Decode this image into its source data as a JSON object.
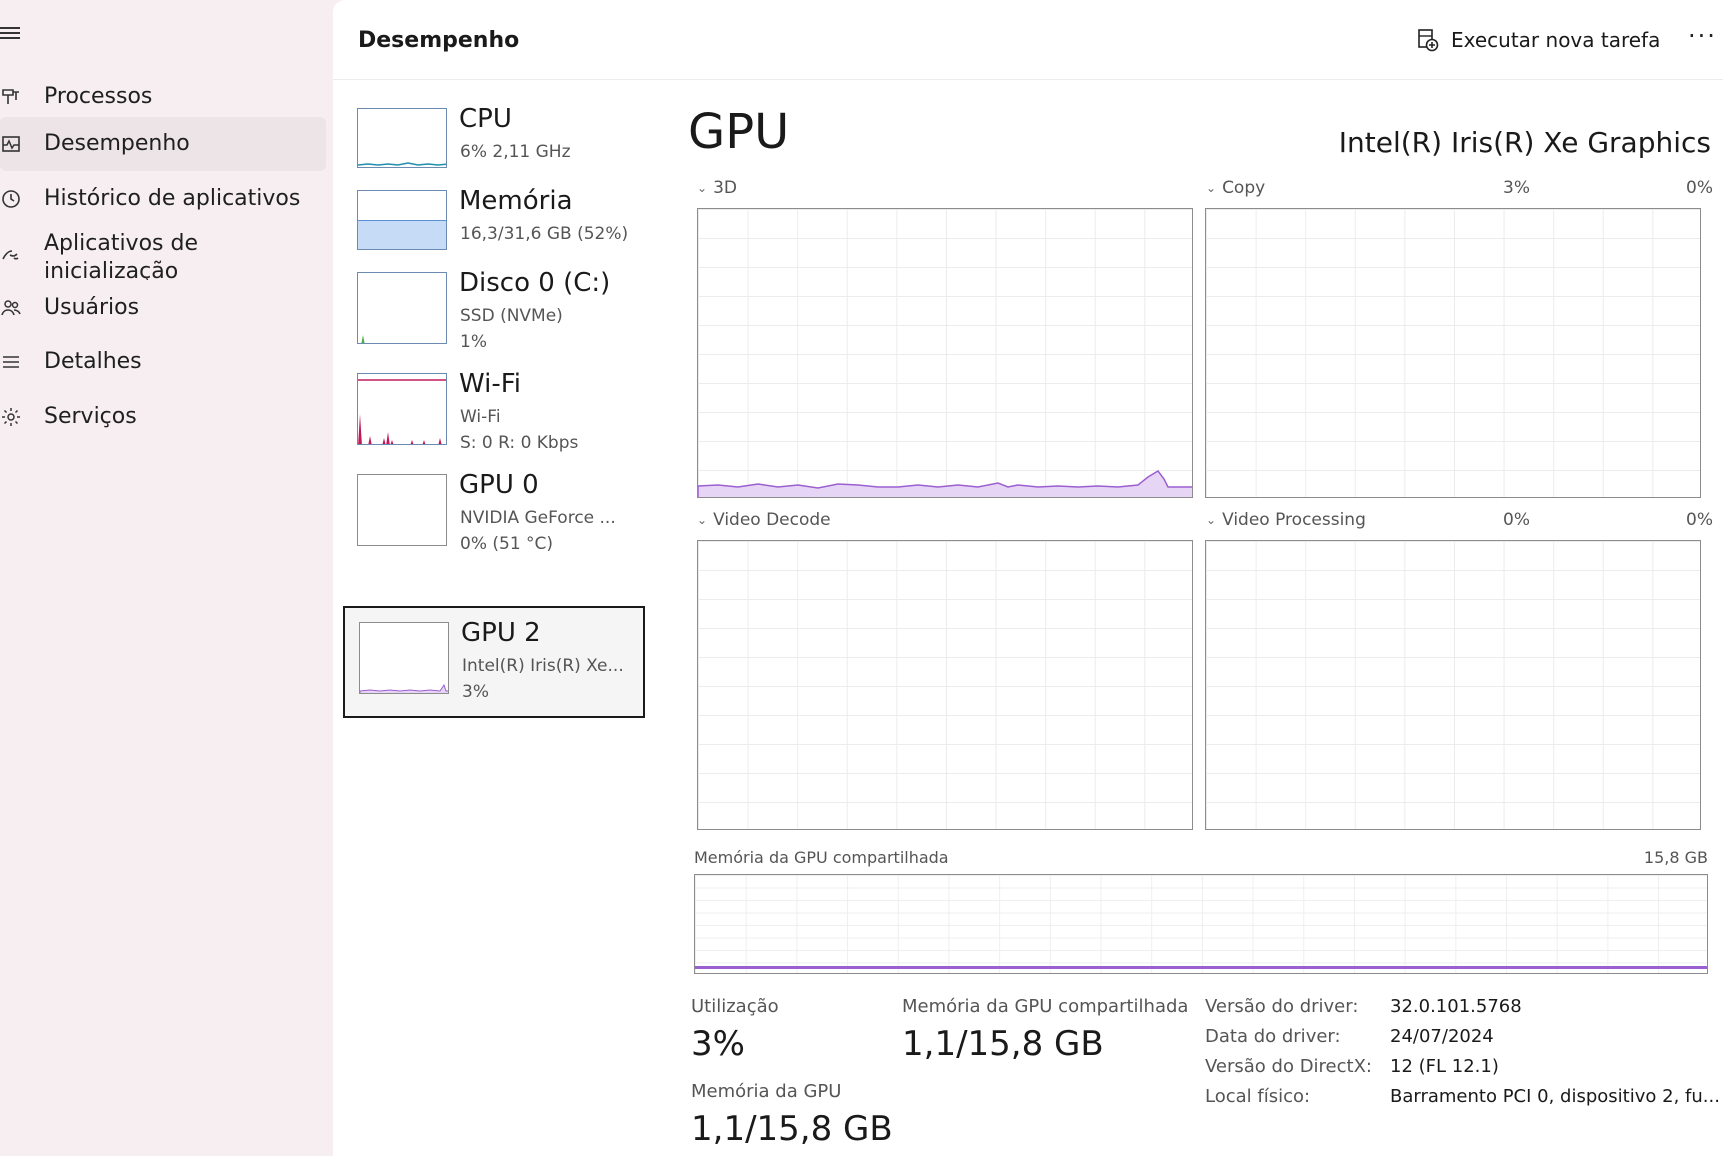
{
  "nav": {
    "items": [
      {
        "label": "Processos",
        "icon": "processes-icon"
      },
      {
        "label": "Desempenho",
        "icon": "performance-icon"
      },
      {
        "label": "Histórico de aplicativos",
        "icon": "history-icon"
      },
      {
        "label": "Aplicativos de inicialização",
        "icon": "startup-icon"
      },
      {
        "label": "Usuários",
        "icon": "users-icon"
      },
      {
        "label": "Detalhes",
        "icon": "details-icon"
      },
      {
        "label": "Serviços",
        "icon": "services-icon"
      }
    ],
    "active_index": 1
  },
  "header": {
    "title": "Desempenho",
    "run_task_label": "Executar nova tarefa",
    "more_label": "···"
  },
  "devices": [
    {
      "name": "CPU",
      "sub1": "6% 2,11 GHz",
      "sub2": "",
      "color": "#1f8fb0"
    },
    {
      "name": "Memória",
      "sub1": "16,3/31,6 GB (52%)",
      "sub2": "",
      "color": "#5b8fd6"
    },
    {
      "name": "Disco 0 (C:)",
      "sub1": "SSD (NVMe)",
      "sub2": "1%",
      "color": "#4caf50"
    },
    {
      "name": "Wi-Fi",
      "sub1": "Wi-Fi",
      "sub2": "S: 0 R: 0 Kbps",
      "color": "#c2185b"
    },
    {
      "name": "GPU 0",
      "sub1": "NVIDIA GeForce ...",
      "sub2": "0% (51 °C)",
      "color": "#8c8c8c"
    },
    {
      "name": "GPU 2",
      "sub1": "Intel(R) Iris(R) Xe...",
      "sub2": "3%",
      "color": "#9b5fd0"
    }
  ],
  "detail": {
    "title": "GPU",
    "model": "Intel(R) Iris(R) Xe Graphics",
    "engines": [
      {
        "name": "3D",
        "value": "3%"
      },
      {
        "name": "Copy",
        "value": "0%"
      },
      {
        "name": "Video Decode",
        "value": "0%"
      },
      {
        "name": "Video Processing",
        "value": "0%"
      }
    ],
    "shared_memory_graph": {
      "label": "Memória da GPU compartilhada",
      "max": "15,8 GB"
    },
    "stats": {
      "utilization_label": "Utilização",
      "utilization_value": "3%",
      "shared_mem_label": "Memória da GPU compartilhada",
      "shared_mem_value": "1,1/15,8 GB",
      "gpu_mem_label": "Memória da GPU",
      "gpu_mem_value": "1,1/15,8 GB"
    },
    "info": [
      {
        "key": "Versão do driver:",
        "value": "32.0.101.5768"
      },
      {
        "key": "Data do driver:",
        "value": "24/07/2024"
      },
      {
        "key": "Versão do DirectX:",
        "value": "12 (FL 12.1)"
      },
      {
        "key": "Local físico:",
        "value": "Barramento PCI 0, dispositivo 2, fu..."
      }
    ]
  },
  "colors": {
    "accent_gpu": "#9b5fd0",
    "graph_fill": "#e7d5f6"
  }
}
